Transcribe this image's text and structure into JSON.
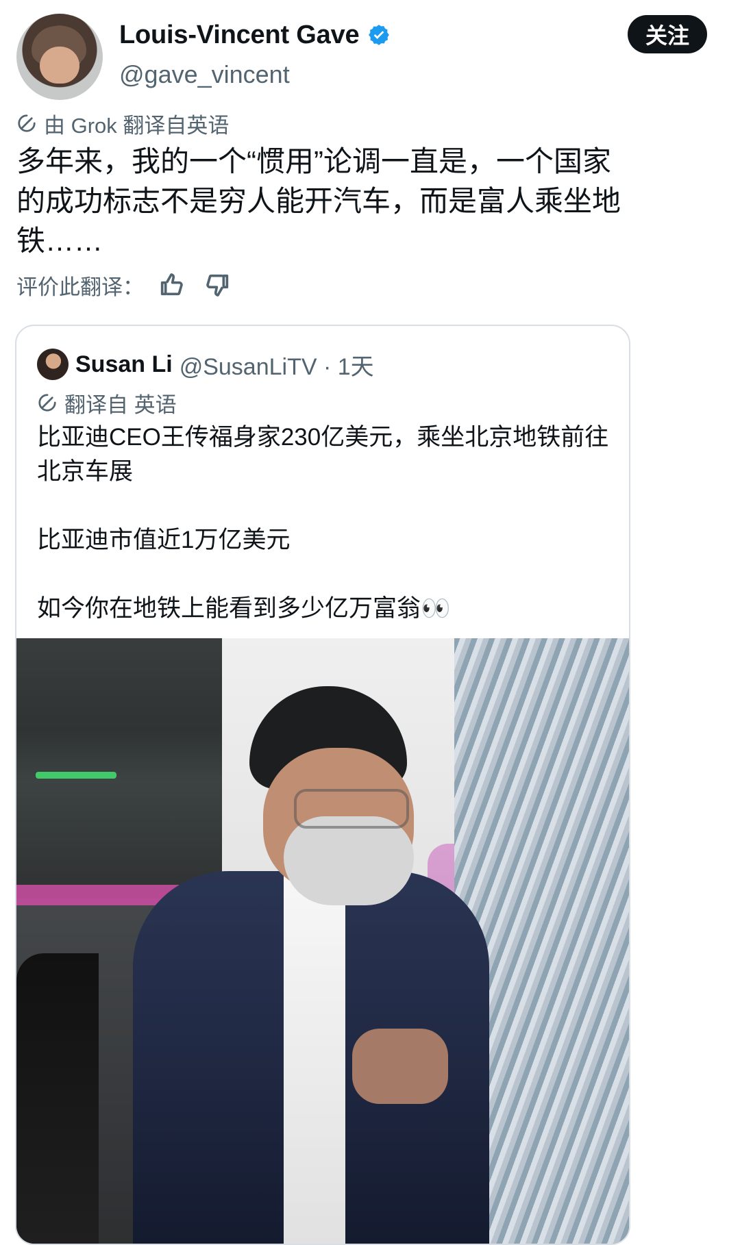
{
  "tweet": {
    "author": {
      "display_name": "Louis-Vincent Gave",
      "handle": "@gave_vincent",
      "avatar_icon": "profile-photo",
      "verified_icon": "verified-badge-icon"
    },
    "follow_button": "关注",
    "translation_notice": "由 Grok 翻译自英语",
    "text": "多年来，我的一个“惯用”论调一直是，一个国家的成功标志不是穷人能开汽车，而是富人乘坐地铁……",
    "rate_translation": "评价此翻译：",
    "rate_icons": [
      "thumbs-up-icon",
      "thumbs-down-icon"
    ]
  },
  "quoted_tweet": {
    "author_name": "Susan Li",
    "handle_time": "@SusanLiTV · 1天",
    "translated_from": "翻译自 英语",
    "paragraphs": [
      "比亚迪CEO王传福身家230亿美元，乘坐北京地铁前往北京车展",
      "比亚迪市值近1万亿美元",
      "如今你在地铁上能看到多少亿万富翁👀"
    ],
    "photo_icon": "subway-photo"
  },
  "colors": {
    "text": "#0f1419",
    "secondary": "#536471",
    "verified": "#1d9bf0",
    "button_bg": "#0f1419",
    "button_text": "#ffffff",
    "border": "#d8dee3"
  }
}
